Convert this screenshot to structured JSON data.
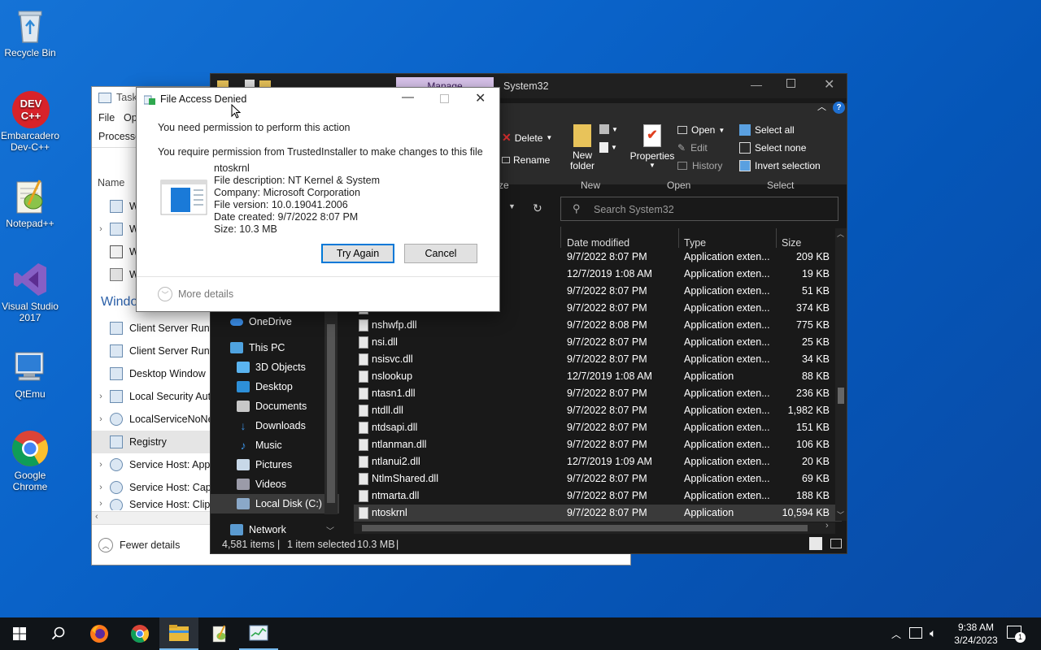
{
  "desktop": {
    "icons": [
      {
        "label": "Recycle Bin",
        "icon": "recycle-bin-icon"
      },
      {
        "label": "Embarcadero Dev-C++",
        "icon": "devcpp-icon",
        "badge": "DEV C++"
      },
      {
        "label": "Notepad++",
        "icon": "notepadpp-icon"
      },
      {
        "label": "Visual Studio 2017",
        "icon": "visual-studio-icon"
      },
      {
        "label": "QtEmu",
        "icon": "qtemu-icon"
      },
      {
        "label": "Google Chrome",
        "icon": "chrome-icon"
      }
    ]
  },
  "taskmgr": {
    "title": "Task",
    "menu": [
      "File",
      "Op"
    ],
    "tab": "Processe",
    "column_name": "Name",
    "group_windows": "Windo",
    "rows": [
      {
        "label": "W",
        "expander": ""
      },
      {
        "label": "W",
        "expander": "›"
      },
      {
        "label": "W",
        "expander": ""
      },
      {
        "label": "W",
        "expander": ""
      },
      {
        "label": "Client Server Runt",
        "expander": ""
      },
      {
        "label": "Client Server Runt",
        "expander": ""
      },
      {
        "label": "Desktop Window",
        "expander": ""
      },
      {
        "label": "Local Security Aut",
        "expander": "›"
      },
      {
        "label": "LocalServiceNoNe",
        "expander": "›"
      },
      {
        "label": "Registry",
        "expander": ""
      },
      {
        "label": "Service Host: Appl",
        "expander": "›"
      },
      {
        "label": "Service Host: Capa",
        "expander": "›"
      },
      {
        "label": "Service Host: Clip",
        "expander": "›"
      }
    ],
    "fewer_details": "Fewer details"
  },
  "explorer": {
    "title": "System32",
    "manage_tab": "Manage",
    "ribbon": {
      "delete": "Delete",
      "rename": "Rename",
      "new_folder": "New folder",
      "properties": "Properties",
      "open": "Open",
      "edit": "Edit",
      "history": "History",
      "select_all": "Select all",
      "select_none": "Select none",
      "invert_selection": "Invert selection",
      "group_organize": "ze",
      "group_new": "New",
      "group_open": "Open",
      "group_select": "Select"
    },
    "search_placeholder": "Search System32",
    "columns": {
      "date": "Date modified",
      "type": "Type",
      "size": "Size"
    },
    "nav": [
      {
        "label": "OneDrive",
        "color": "#3b8ee8"
      },
      {
        "label": "This PC",
        "color": "#4fa3e0"
      },
      {
        "label": "3D Objects",
        "color": "#5ab4f0"
      },
      {
        "label": "Desktop",
        "color": "#2d8fd8"
      },
      {
        "label": "Documents",
        "color": "#c8c8c8"
      },
      {
        "label": "Downloads",
        "color": "#3a8fe0"
      },
      {
        "label": "Music",
        "color": "#3a8fe0"
      },
      {
        "label": "Pictures",
        "color": "#c8d8e8"
      },
      {
        "label": "Videos",
        "color": "#9b9ba8"
      },
      {
        "label": "Local Disk (C:)",
        "color": "#8aa8c8"
      },
      {
        "label": "Network",
        "color": "#5a9ad0"
      }
    ],
    "files": [
      {
        "name": "",
        "date": "9/7/2022 8:07 PM",
        "type": "Application exten...",
        "size": "209 KB"
      },
      {
        "name": "",
        "date": "12/7/2019 1:08 AM",
        "type": "Application exten...",
        "size": "19 KB"
      },
      {
        "name": "",
        "date": "9/7/2022 8:07 PM",
        "type": "Application exten...",
        "size": "51 KB"
      },
      {
        "name": "",
        "date": "9/7/2022 8:07 PM",
        "type": "Application exten...",
        "size": "374 KB"
      },
      {
        "name": "nshwfp.dll",
        "date": "9/7/2022 8:08 PM",
        "type": "Application exten...",
        "size": "775 KB"
      },
      {
        "name": "nsi.dll",
        "date": "9/7/2022 8:07 PM",
        "type": "Application exten...",
        "size": "25 KB"
      },
      {
        "name": "nsisvc.dll",
        "date": "9/7/2022 8:07 PM",
        "type": "Application exten...",
        "size": "34 KB"
      },
      {
        "name": "nslookup",
        "date": "12/7/2019 1:08 AM",
        "type": "Application",
        "size": "88 KB"
      },
      {
        "name": "ntasn1.dll",
        "date": "9/7/2022 8:07 PM",
        "type": "Application exten...",
        "size": "236 KB"
      },
      {
        "name": "ntdll.dll",
        "date": "9/7/2022 8:07 PM",
        "type": "Application exten...",
        "size": "1,982 KB"
      },
      {
        "name": "ntdsapi.dll",
        "date": "9/7/2022 8:07 PM",
        "type": "Application exten...",
        "size": "151 KB"
      },
      {
        "name": "ntlanman.dll",
        "date": "9/7/2022 8:07 PM",
        "type": "Application exten...",
        "size": "106 KB"
      },
      {
        "name": "ntlanui2.dll",
        "date": "12/7/2019 1:09 AM",
        "type": "Application exten...",
        "size": "20 KB"
      },
      {
        "name": "NtlmShared.dll",
        "date": "9/7/2022 8:07 PM",
        "type": "Application exten...",
        "size": "69 KB"
      },
      {
        "name": "ntmarta.dll",
        "date": "9/7/2022 8:07 PM",
        "type": "Application exten...",
        "size": "188 KB"
      },
      {
        "name": "ntoskrnl",
        "date": "9/7/2022 8:07 PM",
        "type": "Application",
        "size": "10,594 KB"
      }
    ],
    "status": {
      "items": "4,581 items",
      "sep": "|",
      "selected": "1 item selected",
      "size": "10.3 MB"
    }
  },
  "dialog": {
    "title": "File Access Denied",
    "heading": "You need permission to perform this action",
    "message": "You require permission from TrustedInstaller to make changes to this file",
    "file_name": "ntoskrnl",
    "file_description": "File description: NT Kernel & System",
    "company": "Company: Microsoft Corporation",
    "version": "File version: 10.0.19041.2006",
    "date_created": "Date created: 9/7/2022 8:07 PM",
    "size": "Size: 10.3 MB",
    "try_again": "Try Again",
    "cancel": "Cancel",
    "more_details": "More details"
  },
  "taskbar": {
    "time": "9:38 AM",
    "date": "3/24/2023",
    "notification_count": "1"
  },
  "colors": {
    "desktop": "#0a63c9",
    "explorer_bg": "#191919",
    "accent": "#0078d7"
  }
}
